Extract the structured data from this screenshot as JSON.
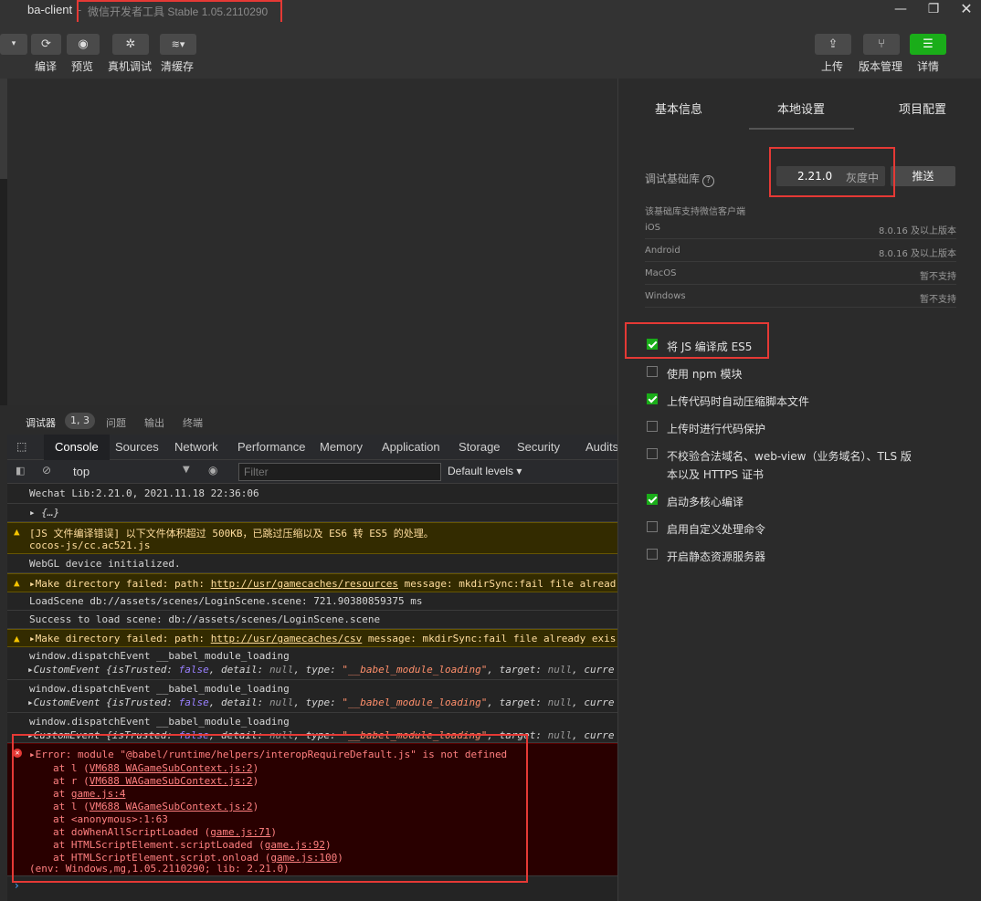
{
  "window": {
    "app_name": "ba-client",
    "separator": "-",
    "subtitle": "微信开发者工具 Stable 1.05.2110290"
  },
  "toolbar": {
    "compile": "编译",
    "preview": "预览",
    "real_debug": "真机调试",
    "clear_cache": "清缓存",
    "upload": "上传",
    "version_mgmt": "版本管理",
    "details": "详情"
  },
  "debugger": {
    "tabs": [
      "调试器",
      "问题",
      "输出",
      "终端"
    ],
    "badge": "1, 3",
    "devtools_tabs": [
      "Console",
      "Sources",
      "Network",
      "Performance",
      "Memory",
      "Application",
      "Storage",
      "Security",
      "Audits"
    ],
    "context": "top",
    "filter_placeholder": "Filter",
    "levels": "Default levels"
  },
  "console": {
    "r1": "Wechat Lib:2.21.0, 2021.11.18 22:36:06",
    "r2": "{…}",
    "r3a": "[JS 文件编译错误] 以下文件体积超过 500KB，已跳过压缩以及 ES6 转 ES5 的处理。",
    "r3b": "cocos-js/cc.ac521.js",
    "r4": "WebGL device initialized.",
    "r5_pre": "Make directory failed: path: ",
    "r5_link": "http://usr/gamecaches/resources",
    "r5_post": " message: mkdirSync:fail file alread",
    "r6": "LoadScene db://assets/scenes/LoginScene.scene: 721.90380859375 ms",
    "r7": "Success to load scene: db://assets/scenes/LoginScene.scene",
    "r8_pre": "Make directory failed: path: ",
    "r8_link": "http://usr/gamecaches/csv",
    "r8_post": " message: mkdirSync:fail file already exis",
    "dispatch": "window.dispatchEvent __babel_module_loading",
    "ev_prefix": "CustomEvent {isTrusted: ",
    "ev_false": "false",
    "ev_detail": ", detail: ",
    "ev_null": "null",
    "ev_type": ", type: ",
    "ev_str": "\"__babel_module_loading\"",
    "ev_target": ", target: ",
    "ev_curr": ", curre",
    "err_main": "Error: module \"@babel/runtime/helpers/interopRequireDefault.js\" is not defined",
    "err_lines": [
      {
        "pre": "at l (",
        "link": "VM688 WAGameSubContext.js:2",
        "post": ")"
      },
      {
        "pre": "at r (",
        "link": "VM688 WAGameSubContext.js:2",
        "post": ")"
      },
      {
        "pre": "at ",
        "link": "game.js:4",
        "post": ""
      },
      {
        "pre": "at l (",
        "link": "VM688 WAGameSubContext.js:2",
        "post": ")"
      },
      {
        "pre": "at <anonymous>:1:63",
        "link": "",
        "post": ""
      },
      {
        "pre": "at doWhenAllScriptLoaded (",
        "link": "game.js:71",
        "post": ")"
      },
      {
        "pre": "at HTMLScriptElement.scriptLoaded (",
        "link": "game.js:92",
        "post": ")"
      },
      {
        "pre": "at HTMLScriptElement.script.onload (",
        "link": "game.js:100",
        "post": ")"
      }
    ],
    "err_env": "(env: Windows,mg,1.05.2110290; lib: 2.21.0)"
  },
  "right_panel": {
    "tabs": [
      "基本信息",
      "本地设置",
      "项目配置"
    ],
    "debug_lib_label": "调试基础库",
    "version": "2.21.0",
    "gray": "灰度中",
    "push": "推送",
    "support_note": "该基础库支持微信客户端",
    "platforms": [
      {
        "name": "iOS",
        "value": "8.0.16 及以上版本"
      },
      {
        "name": "Android",
        "value": "8.0.16 及以上版本"
      },
      {
        "name": "MacOS",
        "value": "暂不支持"
      },
      {
        "name": "Windows",
        "value": "暂不支持"
      }
    ],
    "options": [
      {
        "label": "将 JS 编译成 ES5",
        "checked": true
      },
      {
        "label": "使用 npm 模块",
        "checked": false
      },
      {
        "label": "上传代码时自动压缩脚本文件",
        "checked": true
      },
      {
        "label": "上传时进行代码保护",
        "checked": false
      },
      {
        "label": "不校验合法域名、web-view（业务域名）、TLS 版",
        "label2": "本以及 HTTPS 证书",
        "checked": false
      },
      {
        "label": "启动多核心编译",
        "checked": true
      },
      {
        "label": "启用自定义处理命令",
        "checked": false
      },
      {
        "label": "开启静态资源服务器",
        "checked": false
      }
    ]
  },
  "colors": {
    "accent_green": "#1aad19",
    "highlight_red": "#e53935"
  }
}
